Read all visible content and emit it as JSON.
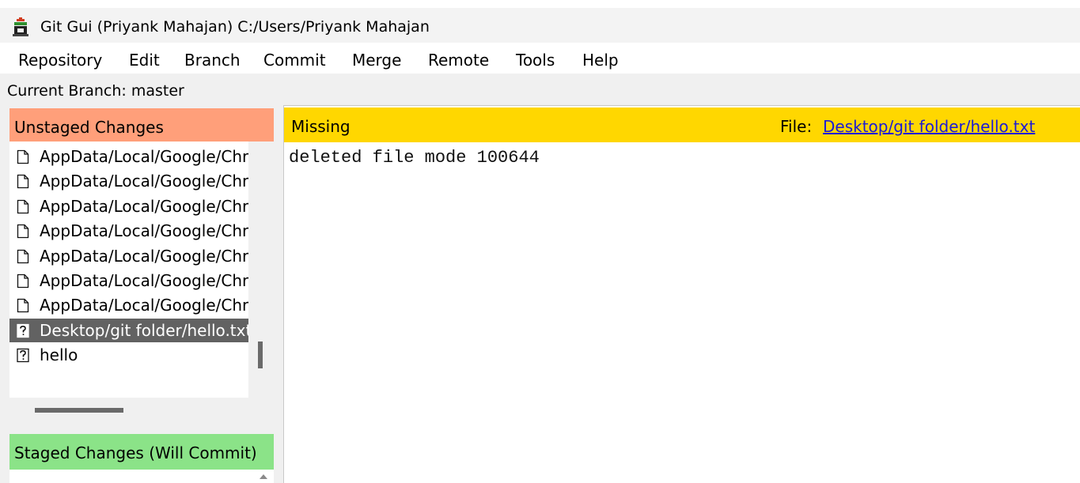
{
  "window": {
    "title": "Git Gui (Priyank Mahajan) C:/Users/Priyank Mahajan",
    "icon": "git-gui-icon"
  },
  "menu": [
    "Repository",
    "Edit",
    "Branch",
    "Commit",
    "Merge",
    "Remote",
    "Tools",
    "Help"
  ],
  "branch": {
    "label": "Current Branch: master"
  },
  "unstaged": {
    "header": "Unstaged Changes",
    "files": [
      {
        "name": "AppData/Local/Google/Chrome",
        "icon": "file-icon",
        "selected": false
      },
      {
        "name": "AppData/Local/Google/Chrome",
        "icon": "file-icon",
        "selected": false
      },
      {
        "name": "AppData/Local/Google/Chrome",
        "icon": "file-icon",
        "selected": false
      },
      {
        "name": "AppData/Local/Google/Chrome",
        "icon": "file-icon",
        "selected": false
      },
      {
        "name": "AppData/Local/Google/Chrome",
        "icon": "file-icon",
        "selected": false
      },
      {
        "name": "AppData/Local/Google/Chrome",
        "icon": "file-icon",
        "selected": false
      },
      {
        "name": "AppData/Local/Google/Chrome",
        "icon": "file-icon",
        "selected": false
      },
      {
        "name": "Desktop/git folder/hello.txt",
        "icon": "unknown-file-icon",
        "selected": true
      },
      {
        "name": "hello",
        "icon": "unknown-file-icon",
        "selected": false
      }
    ]
  },
  "staged": {
    "header": "Staged Changes (Will Commit)"
  },
  "diff": {
    "status": "Missing",
    "file_label": "File:",
    "file_path": "Desktop/git folder/hello.txt",
    "content": "deleted file mode 100644"
  },
  "colors": {
    "unstaged_header": "#ff9f7a",
    "staged_header": "#8be388",
    "diff_header": "#ffd700",
    "selection": "#626262",
    "link": "#1a1ad8"
  }
}
